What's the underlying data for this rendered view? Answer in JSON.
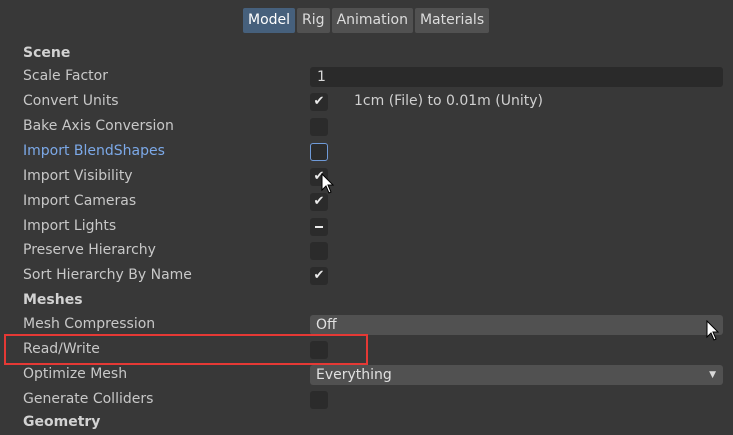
{
  "tabs": [
    {
      "label": "Model",
      "active": true
    },
    {
      "label": "Rig",
      "active": false
    },
    {
      "label": "Animation",
      "active": false
    },
    {
      "label": "Materials",
      "active": false
    }
  ],
  "scene": {
    "header": "Scene",
    "scale_factor_label": "Scale Factor",
    "scale_factor_value": "1",
    "convert_units_label": "Convert Units",
    "convert_units_checked": true,
    "convert_units_text": "1cm (File) to 0.01m (Unity)",
    "bake_axis_label": "Bake Axis Conversion",
    "bake_axis_checked": false,
    "import_blendshapes_label": "Import BlendShapes",
    "import_blendshapes_checked": false,
    "import_visibility_label": "Import Visibility",
    "import_visibility_checked": true,
    "import_cameras_label": "Import Cameras",
    "import_cameras_checked": true,
    "import_lights_label": "Import Lights",
    "import_lights_state": "mixed",
    "preserve_hierarchy_label": "Preserve Hierarchy",
    "preserve_hierarchy_checked": false,
    "sort_hierarchy_label": "Sort Hierarchy By Name",
    "sort_hierarchy_checked": true
  },
  "meshes": {
    "header": "Meshes",
    "mesh_compression_label": "Mesh Compression",
    "mesh_compression_value": "Off",
    "read_write_label": "Read/Write",
    "read_write_checked": false,
    "optimize_mesh_label": "Optimize Mesh",
    "optimize_mesh_value": "Everything",
    "generate_colliders_label": "Generate Colliders",
    "generate_colliders_checked": false
  },
  "geometry": {
    "header": "Geometry"
  },
  "icons": {
    "check": "check-icon",
    "mixed": "mixed-dash-icon",
    "dropdown_arrow": "triangle-down-icon",
    "cursor": "mouse-pointer-icon"
  },
  "colors": {
    "background": "#383838",
    "active_tab": "#46607c",
    "highlight_label": "#7ca9e8",
    "annotation_box": "#e53935"
  }
}
